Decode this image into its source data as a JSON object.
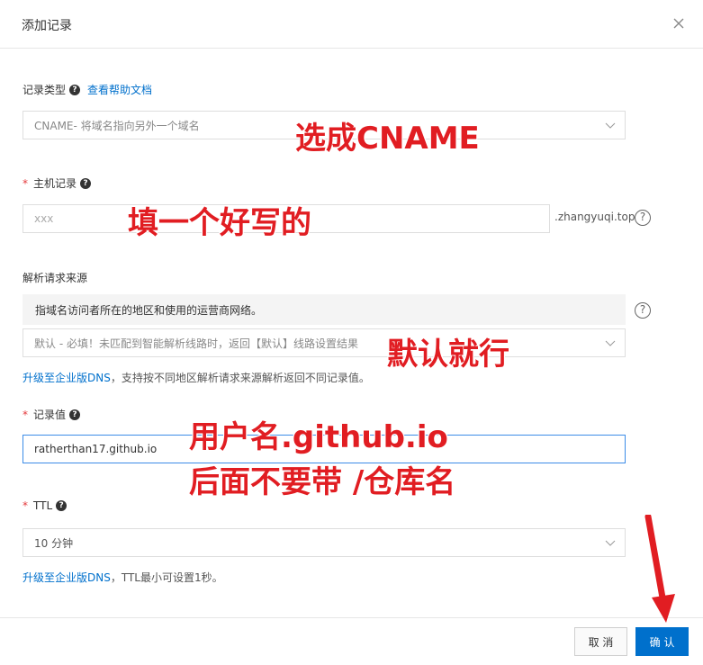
{
  "dialog": {
    "title": "添加记录"
  },
  "record_type": {
    "label": "记录类型",
    "help_link": "查看帮助文档",
    "value": "CNAME- 将域名指向另外一个域名"
  },
  "host_record": {
    "required_mark": "*",
    "label": "主机记录",
    "placeholder": "xxx",
    "suffix": ".zhangyuqi.top"
  },
  "resolve_source": {
    "label": "解析请求来源",
    "info": "指域名访问者所在的地区和使用的运营商网络。",
    "value": "默认 - 必填！未匹配到智能解析线路时，返回【默认】线路设置结果"
  },
  "upgrade_hint_1": {
    "link": "升级至企业版DNS",
    "text": "，支持按不同地区解析请求来源解析返回不同记录值。"
  },
  "record_value": {
    "required_mark": "*",
    "label": "记录值",
    "value": "ratherthan17.github.io"
  },
  "ttl": {
    "required_mark": "*",
    "label": "TTL",
    "value": "10 分钟"
  },
  "upgrade_hint_2": {
    "link": "升级至企业版DNS",
    "text": "，TTL最小可设置1秒。"
  },
  "buttons": {
    "cancel": "取 消",
    "confirm": "确 认"
  },
  "annotations": {
    "a1": "选成CNAME",
    "a2": "填一个好写的",
    "a3": "默认就行",
    "a4_line1": "用户名.github.io",
    "a4_line2": "后面不要带  /仓库名"
  },
  "colors": {
    "accent": "#0070cc",
    "annotation": "#e11d22",
    "required": "#e4393c",
    "focus_border": "#3c8ce7"
  },
  "icons": [
    "close-icon",
    "question-icon",
    "chevron-down-icon",
    "help-circle-icon",
    "red-arrow"
  ]
}
